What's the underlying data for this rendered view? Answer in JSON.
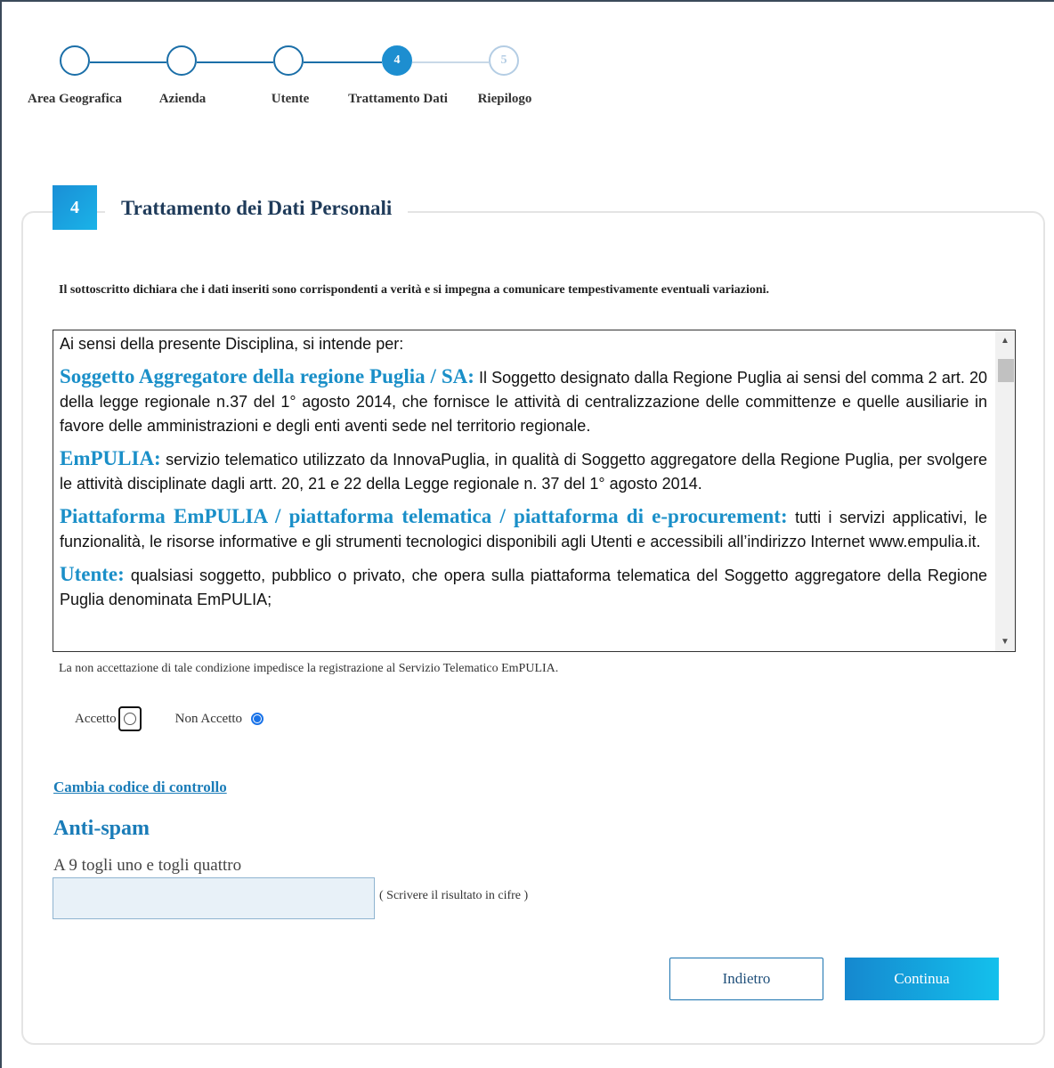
{
  "stepper": {
    "steps": [
      {
        "number": "",
        "label": "Area Geografica"
      },
      {
        "number": "",
        "label": "Azienda"
      },
      {
        "number": "",
        "label": "Utente"
      },
      {
        "number": "4",
        "label": "Trattamento Dati"
      },
      {
        "number": "5",
        "label": "Riepilogo"
      }
    ],
    "current_step": 4
  },
  "section": {
    "number": "4",
    "title": "Trattamento dei Dati Personali"
  },
  "declaration": "Il sottoscritto dichiara che i dati inseriti sono corrispondenti a verità e si impegna a comunicare tempestivamente eventuali variazioni.",
  "terms": {
    "intro": "Ai sensi della presente Disciplina, si intende per:",
    "items": [
      {
        "key": "Soggetto Aggregatore della regione Puglia / SA:",
        "text": " Il Soggetto designato dalla Regione Puglia ai sensi del comma 2 art. 20 della legge regionale n.37 del 1° agosto 2014, che fornisce le attività di centralizzazione delle committenze e quelle ausiliarie in favore delle amministrazioni e degli enti aventi sede nel territorio regionale."
      },
      {
        "key": "EmPULIA:",
        "text": " servizio telematico utilizzato da InnovaPuglia, in qualità di Soggetto aggregatore della Regione Puglia, per svolgere le attività disciplinate dagli artt. 20, 21 e 22 della Legge regionale n. 37 del 1° agosto 2014."
      },
      {
        "key": "Piattaforma EmPULIA / piattaforma telematica / piattaforma di e-procurement:",
        "text": " tutti i servizi applicativi, le funzionalità, le risorse informative e gli strumenti tecnologici disponibili agli Utenti e accessibili all’indirizzo Internet www.empulia.it."
      },
      {
        "key": "Utente:",
        "text": " qualsiasi soggetto, pubblico o privato, che opera sulla piattaforma telematica del Soggetto aggregatore della Regione Puglia denominata EmPULIA;"
      }
    ]
  },
  "non_accept_note": "La non accettazione di tale condizione impedisce la registrazione al Servizio Telematico EmPULIA.",
  "consent": {
    "accept_label": "Accetto",
    "reject_label": "Non Accetto",
    "selected": "Non Accetto"
  },
  "change_code_link": "Cambia codice di controllo",
  "antispam": {
    "title": "Anti-spam",
    "question": "A 9 togli uno e togli quattro",
    "value": "",
    "hint": "( Scrivere il risultato in cifre )"
  },
  "buttons": {
    "back": "Indietro",
    "next": "Continua"
  },
  "colors": {
    "accent": "#1a8fd6",
    "link": "#1a7cb8",
    "step_line": "#1b6fa8"
  }
}
